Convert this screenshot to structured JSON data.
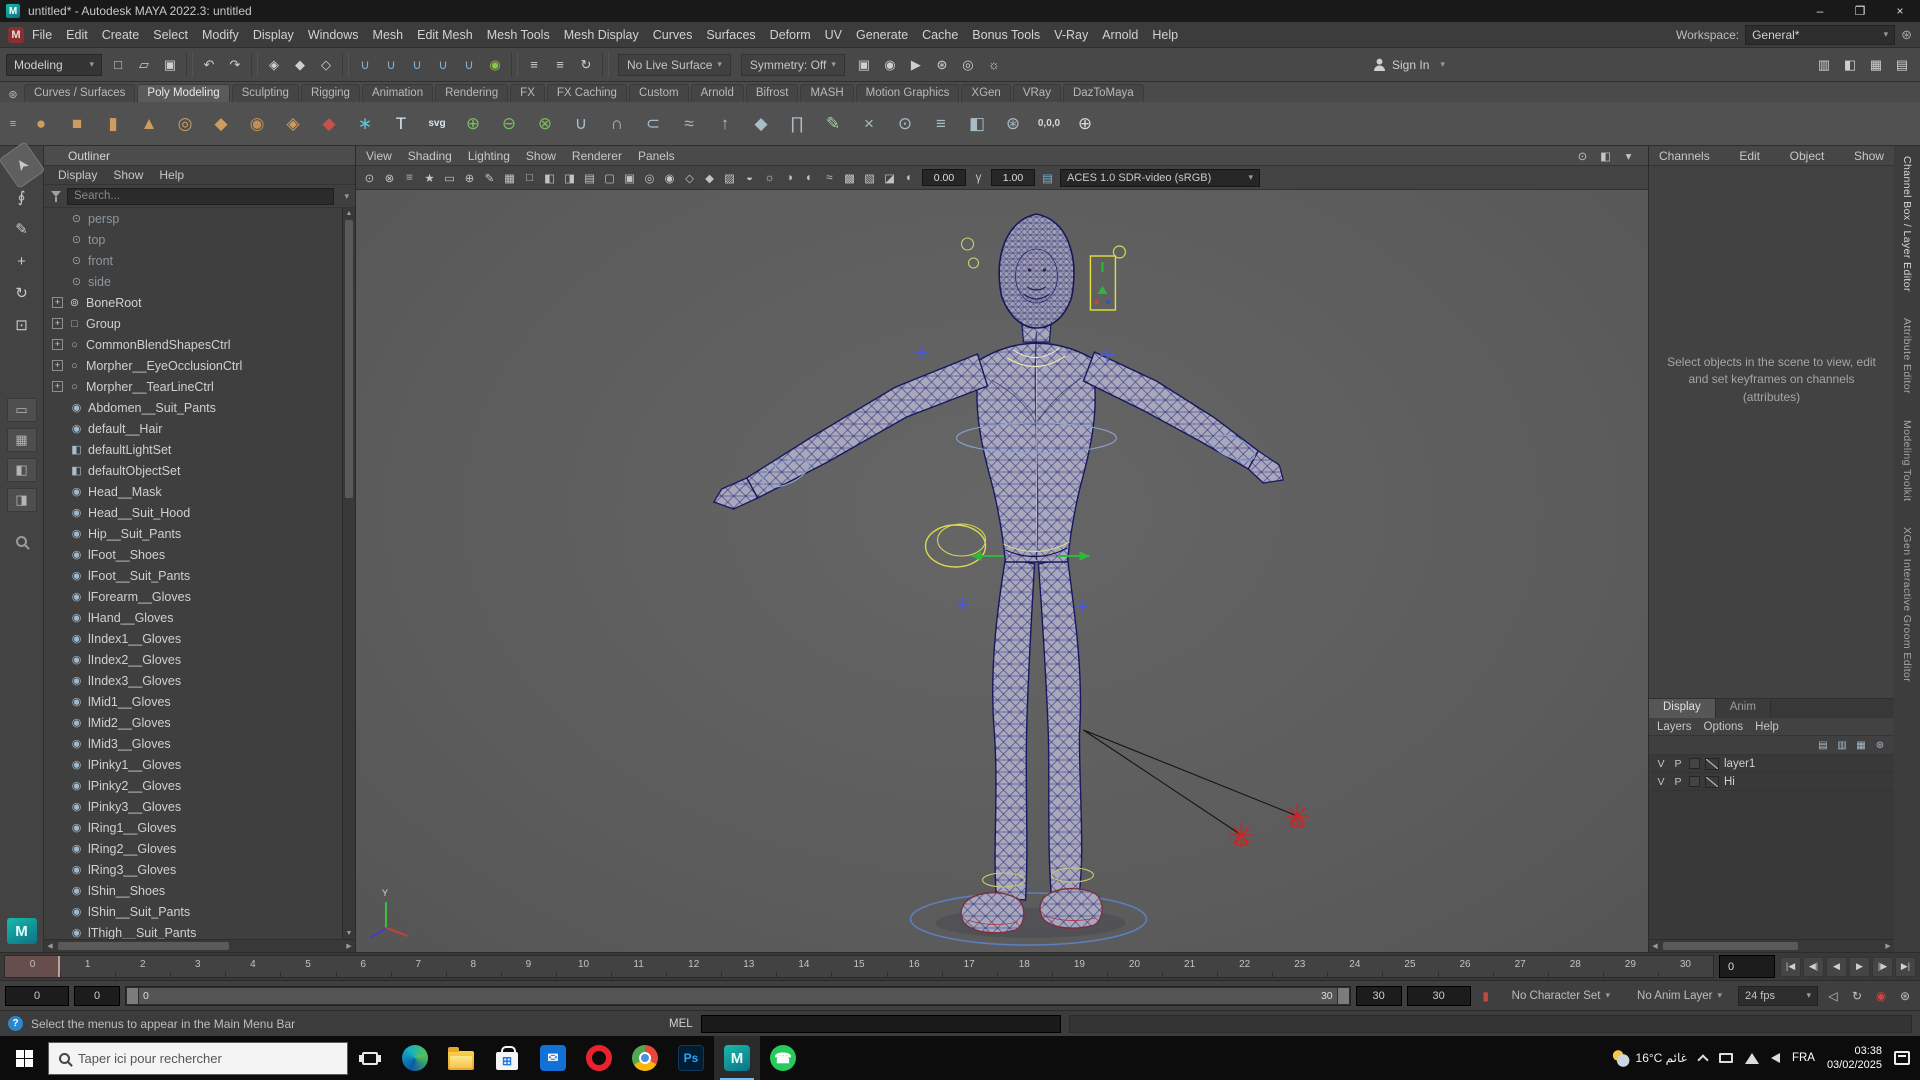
{
  "titlebar": {
    "title": "untitled* - Autodesk MAYA 2022.3: untitled"
  },
  "menubar": {
    "items": [
      "File",
      "Edit",
      "Create",
      "Select",
      "Modify",
      "Display",
      "Windows",
      "Mesh",
      "Edit Mesh",
      "Mesh Tools",
      "Mesh Display",
      "Curves",
      "Surfaces",
      "Deform",
      "UV",
      "Generate",
      "Cache",
      "Bonus Tools",
      "V-Ray",
      "Arnold",
      "Help"
    ],
    "workspace_label": "Workspace:",
    "workspace_value": "General*"
  },
  "toolbar": {
    "menuset": "Modeling",
    "live_surface": "No Live Surface",
    "symmetry": "Symmetry: Off",
    "sign_in": "Sign In",
    "left_icons": [
      {
        "n": "new-scene",
        "g": "□"
      },
      {
        "n": "open-scene",
        "g": "▱"
      },
      {
        "n": "save-scene",
        "g": "▣"
      },
      "|",
      {
        "n": "undo",
        "g": "↶"
      },
      {
        "n": "redo",
        "g": "↷"
      },
      "|",
      {
        "n": "select-by-hierarchy",
        "g": "◈"
      },
      {
        "n": "select-by-object",
        "g": "◆"
      },
      {
        "n": "select-by-component",
        "g": "◇"
      },
      "|",
      {
        "n": "snap-to-grid",
        "g": "∪",
        "c": "#7fb2d6"
      },
      {
        "n": "snap-to-curve",
        "g": "∪",
        "c": "#7fb2d6"
      },
      {
        "n": "snap-to-point",
        "g": "∪",
        "c": "#7fb2d6"
      },
      {
        "n": "snap-to-projected-center",
        "g": "∪",
        "c": "#7fb2d6"
      },
      {
        "n": "snap-to-view-plane",
        "g": "∪",
        "c": "#7fb2d6"
      },
      {
        "n": "make-object-live",
        "g": "◉",
        "c": "#8bc34a"
      },
      "|",
      {
        "n": "input-connections",
        "g": "≡"
      },
      {
        "n": "output-connections",
        "g": "≡"
      },
      {
        "n": "construction-history",
        "g": "↻"
      },
      "|"
    ],
    "render_icons": [
      {
        "n": "render-current-frame",
        "g": "▣"
      },
      {
        "n": "ipr-render",
        "g": "◉"
      },
      {
        "n": "render-sequence",
        "g": "▶"
      },
      {
        "n": "render-settings",
        "g": "⊛"
      },
      {
        "n": "hypershade",
        "g": "◎"
      },
      {
        "n": "light-editor",
        "g": "☼"
      }
    ],
    "corner_icons": [
      {
        "n": "panel-layout-single",
        "g": "▥"
      },
      {
        "n": "panel-layout-split",
        "g": "◧"
      },
      {
        "n": "panel-layout-quad",
        "g": "▦"
      },
      {
        "n": "panel-layout-custom",
        "g": "▤"
      }
    ]
  },
  "shelf": {
    "tabs": [
      "Curves / Surfaces",
      "Poly Modeling",
      "Sculpting",
      "Rigging",
      "Animation",
      "Rendering",
      "FX",
      "FX Caching",
      "Custom",
      "Arnold",
      "Bifrost",
      "MASH",
      "Motion Graphics",
      "XGen",
      "VRay",
      "DazToMaya"
    ],
    "active_tab": "Poly Modeling",
    "icons": [
      {
        "n": "poly-sphere",
        "g": "●",
        "c": "#cf9c5f"
      },
      {
        "n": "poly-cube",
        "g": "■",
        "c": "#cf9c5f"
      },
      {
        "n": "poly-cylinder",
        "g": "▮",
        "c": "#cf9c5f"
      },
      {
        "n": "poly-cone",
        "g": "▲",
        "c": "#cf9c5f"
      },
      {
        "n": "poly-torus",
        "g": "◎",
        "c": "#cf9c5f"
      },
      {
        "n": "poly-plane",
        "g": "◆",
        "c": "#cf9c5f"
      },
      {
        "n": "poly-disc",
        "g": "◉",
        "c": "#c08f55"
      },
      {
        "n": "platonic-solid",
        "g": "◈",
        "c": "#cf9c5f"
      },
      {
        "n": "super-shape",
        "g": "◆",
        "c": "#c6524a"
      },
      {
        "n": "sculpt-mesh",
        "g": "∗",
        "c": "#62c2d8"
      },
      {
        "n": "type-tool",
        "g": "T",
        "c": "#d7e7f2"
      },
      {
        "n": "svg-tool",
        "g": "svg",
        "c": "#d7e7f2"
      },
      {
        "n": "boolean-union",
        "g": "⊕",
        "c": "#7fba5f"
      },
      {
        "n": "boolean-difference",
        "g": "⊖",
        "c": "#7fba5f"
      },
      {
        "n": "boolean-intersection",
        "g": "⊗",
        "c": "#7fba5f"
      },
      {
        "n": "combine",
        "g": "∪",
        "c": "#a9bcc6"
      },
      {
        "n": "separate",
        "g": "∩",
        "c": "#a9bcc6"
      },
      {
        "n": "extract",
        "g": "⊂",
        "c": "#a9bcc6"
      },
      {
        "n": "smooth",
        "g": "≈",
        "c": "#a9bcc6"
      },
      {
        "n": "extrude",
        "g": "↑",
        "c": "#a9bcc6"
      },
      {
        "n": "bevel",
        "g": "◆",
        "c": "#a9bcc6"
      },
      {
        "n": "bridge",
        "g": "∏",
        "c": "#a9bcc6"
      },
      {
        "n": "quad-draw",
        "g": "✎",
        "c": "#9fd09f"
      },
      {
        "n": "multi-cut",
        "g": "×",
        "c": "#a9bcc6"
      },
      {
        "n": "target-weld",
        "g": "⊙",
        "c": "#a9bcc6"
      },
      {
        "n": "connect",
        "g": "≡",
        "c": "#a9bcc6"
      },
      {
        "n": "mirror",
        "g": "◧",
        "c": "#a9bcc6"
      },
      {
        "n": "average-vertices",
        "g": "⊛",
        "c": "#a9bcc6"
      },
      {
        "n": "move-to-origin",
        "g": "0,0,0",
        "c": "#d8d8d8"
      },
      {
        "n": "center-pivot",
        "g": "⊕",
        "c": "#d8d8d8"
      }
    ]
  },
  "toolbox": {
    "tools": [
      {
        "n": "select-tool",
        "g": "➤",
        "active": true,
        "rot": true
      },
      {
        "n": "lasso-tool",
        "g": "∮"
      },
      {
        "n": "paint-select-tool",
        "g": "✎"
      },
      {
        "n": "move-tool",
        "g": "+"
      },
      {
        "n": "rotate-tool",
        "g": "↻"
      },
      {
        "n": "scale-tool",
        "g": "⊡"
      }
    ],
    "layouts": [
      {
        "n": "single-pane-layout",
        "g": "▭"
      },
      {
        "n": "four-pane-layout",
        "g": "▦"
      },
      {
        "n": "persp-outliner-layout",
        "g": "◧"
      },
      {
        "n": "persp-graph-layout",
        "g": "◨"
      }
    ]
  },
  "outliner": {
    "title": "Outliner",
    "menus": [
      "Display",
      "Show",
      "Help"
    ],
    "search_placeholder": "Search...",
    "items": [
      {
        "label": "persp",
        "icon": "camera",
        "muted": true
      },
      {
        "label": "top",
        "icon": "camera",
        "muted": true
      },
      {
        "label": "front",
        "icon": "camera",
        "muted": true
      },
      {
        "label": "side",
        "icon": "camera",
        "muted": true
      },
      {
        "label": "BoneRoot",
        "icon": "joint",
        "expand": true
      },
      {
        "label": "Group",
        "icon": "group",
        "expand": true
      },
      {
        "label": "CommonBlendShapesCtrl",
        "icon": "curve",
        "expand": true
      },
      {
        "label": "Morpher__EyeOcclusionCtrl",
        "icon": "curve",
        "expand": true
      },
      {
        "label": "Morpher__TearLineCtrl",
        "icon": "curve",
        "expand": true
      },
      {
        "label": "Abdomen__Suit_Pants",
        "icon": "mesh"
      },
      {
        "label": "default__Hair",
        "icon": "mesh"
      },
      {
        "label": "defaultLightSet",
        "icon": "set"
      },
      {
        "label": "defaultObjectSet",
        "icon": "set"
      },
      {
        "label": "Head__Mask",
        "icon": "mesh"
      },
      {
        "label": "Head__Suit_Hood",
        "icon": "mesh"
      },
      {
        "label": "Hip__Suit_Pants",
        "icon": "mesh"
      },
      {
        "label": "lFoot__Shoes",
        "icon": "mesh"
      },
      {
        "label": "lFoot__Suit_Pants",
        "icon": "mesh"
      },
      {
        "label": "lForearm__Gloves",
        "icon": "mesh"
      },
      {
        "label": "lHand__Gloves",
        "icon": "mesh"
      },
      {
        "label": "lIndex1__Gloves",
        "icon": "mesh"
      },
      {
        "label": "lIndex2__Gloves",
        "icon": "mesh"
      },
      {
        "label": "lIndex3__Gloves",
        "icon": "mesh"
      },
      {
        "label": "lMid1__Gloves",
        "icon": "mesh"
      },
      {
        "label": "lMid2__Gloves",
        "icon": "mesh"
      },
      {
        "label": "lMid3__Gloves",
        "icon": "mesh"
      },
      {
        "label": "lPinky1__Gloves",
        "icon": "mesh"
      },
      {
        "label": "lPinky2__Gloves",
        "icon": "mesh"
      },
      {
        "label": "lPinky3__Gloves",
        "icon": "mesh"
      },
      {
        "label": "lRing1__Gloves",
        "icon": "mesh"
      },
      {
        "label": "lRing2__Gloves",
        "icon": "mesh"
      },
      {
        "label": "lRing3__Gloves",
        "icon": "mesh"
      },
      {
        "label": "lShin__Shoes",
        "icon": "mesh"
      },
      {
        "label": "lShin__Suit_Pants",
        "icon": "mesh"
      },
      {
        "label": "lThigh__Suit_Pants",
        "icon": "mesh"
      }
    ]
  },
  "viewport": {
    "menus": [
      "View",
      "Shading",
      "Lighting",
      "Show",
      "Renderer",
      "Panels"
    ],
    "panel_icons": [
      {
        "n": "pin-panel",
        "g": "⊙"
      },
      {
        "n": "maximize-panel",
        "g": "◧"
      },
      {
        "n": "panel-menu",
        "g": "▾"
      }
    ],
    "toolbar_icons": [
      {
        "n": "select-camera",
        "g": "⊙"
      },
      {
        "n": "lock-camera",
        "g": "⊗"
      },
      {
        "n": "camera-attributes",
        "g": "≡"
      },
      {
        "n": "bookmark",
        "g": "★"
      },
      {
        "n": "image-plane",
        "g": "▭"
      },
      {
        "n": "two-d-pan-zoom",
        "g": "⊕"
      },
      {
        "n": "grease-pencil",
        "g": "✎"
      },
      {
        "n": "grid",
        "g": "▦"
      },
      {
        "n": "film-gate",
        "g": "□"
      },
      {
        "n": "resolution-gate",
        "g": "◧"
      },
      {
        "n": "gate-mask",
        "g": "◨"
      },
      {
        "n": "field-chart",
        "g": "▤"
      },
      {
        "n": "safe-action",
        "g": "▢"
      },
      {
        "n": "safe-title",
        "g": "▣"
      },
      {
        "n": "frame-all",
        "g": "◎"
      },
      {
        "n": "frame-selection",
        "g": "◉"
      },
      {
        "n": "wireframe-display",
        "g": "◇"
      },
      {
        "n": "smooth-shade",
        "g": "◆"
      },
      {
        "n": "textured-display",
        "g": "▨"
      },
      {
        "n": "use-default-material",
        "g": "◒"
      },
      {
        "n": "lighting-toggle",
        "g": "☼"
      },
      {
        "n": "shadows-toggle",
        "g": "◑"
      },
      {
        "n": "screen-space-ao",
        "g": "◐"
      },
      {
        "n": "motion-blur",
        "g": "≈"
      },
      {
        "n": "anti-aliasing",
        "g": "▩"
      },
      {
        "n": "x-ray",
        "g": "▧"
      },
      {
        "n": "isolate-select",
        "g": "◪"
      }
    ],
    "exposure": "0.00",
    "gamma": "1.00",
    "colorspace": "ACES 1.0 SDR-video (sRGB)"
  },
  "channel_box": {
    "menus": [
      "Channels",
      "Edit",
      "Object",
      "Show"
    ],
    "empty_message": "Select objects in the scene to view, edit and set keyframes on channels (attributes)"
  },
  "layer_editor": {
    "tabs": [
      "Display",
      "Anim"
    ],
    "menus": [
      "Layers",
      "Options",
      "Help"
    ],
    "icons": [
      {
        "n": "create-empty-layer",
        "g": "▤"
      },
      {
        "n": "create-layer-from-selected",
        "g": "▥"
      },
      {
        "n": "sort-layers",
        "g": "▦"
      },
      {
        "n": "layer-options",
        "g": "⊛"
      }
    ],
    "layers": [
      {
        "visible": "V",
        "playback": "P",
        "name": "layer1"
      },
      {
        "visible": "V",
        "playback": "P",
        "name": "Hi"
      }
    ]
  },
  "right_tabs": [
    "Channel Box / Layer Editor",
    "Attribute Editor",
    "Modeling Toolkit",
    "XGen Interactive Groom Editor"
  ],
  "timeline": {
    "ticks": [
      0,
      1,
      2,
      3,
      4,
      5,
      6,
      7,
      8,
      9,
      10,
      11,
      12,
      13,
      14,
      15,
      16,
      17,
      18,
      19,
      20,
      21,
      22,
      23,
      24,
      25,
      26,
      27,
      28,
      29,
      30
    ],
    "current": "0",
    "playback": [
      {
        "n": "go-to-start",
        "g": "|◀"
      },
      {
        "n": "step-back-frame",
        "g": "◀|"
      },
      {
        "n": "play-backwards",
        "g": "◀"
      },
      {
        "n": "play-forwards",
        "g": "▶"
      },
      {
        "n": "step-forward-frame",
        "g": "|▶"
      },
      {
        "n": "go-to-end",
        "g": "▶|"
      }
    ]
  },
  "range": {
    "anim_start": "0",
    "play_start": "0",
    "slider_start": "0",
    "slider_end": "30",
    "play_end": "30",
    "anim_end": "30",
    "character_set": "No Character Set",
    "anim_layer": "No Anim Layer",
    "fps": "24 fps",
    "icons": [
      {
        "n": "mute-playback",
        "g": "◁"
      },
      {
        "n": "loop-playback",
        "g": "↻"
      },
      {
        "n": "auto-keyframe",
        "g": "◉",
        "c": "#cc4444"
      },
      {
        "n": "animation-preferences",
        "g": "⊛"
      }
    ]
  },
  "statusline": {
    "help_text": "Select the menus to appear in the Main Menu Bar",
    "mel_label": "MEL"
  },
  "taskbar": {
    "search_placeholder": "Taper ici pour rechercher",
    "apps": [
      {
        "name": "edge"
      },
      {
        "name": "file-explorer"
      },
      {
        "name": "microsoft-store",
        "g": "⊞"
      },
      {
        "name": "mail",
        "g": "✉"
      },
      {
        "name": "opera"
      },
      {
        "name": "chrome"
      },
      {
        "name": "photoshop",
        "g": "Ps"
      },
      {
        "name": "maya",
        "g": "M",
        "active": true
      },
      {
        "name": "whatsapp",
        "g": "☎"
      }
    ],
    "tray": {
      "weather": "16°C غائم",
      "lang": "FRA",
      "time": "03:38",
      "date": "03/02/2025"
    }
  },
  "colors": {
    "viewport_bg": "#5e5e5e",
    "wireframe_navy": "#23237a",
    "manipulator_green": "#2db83d",
    "locator_red": "#cc2525",
    "ground_circle_blue": "#5c7fc0",
    "control_yellow": "#d9d955"
  }
}
